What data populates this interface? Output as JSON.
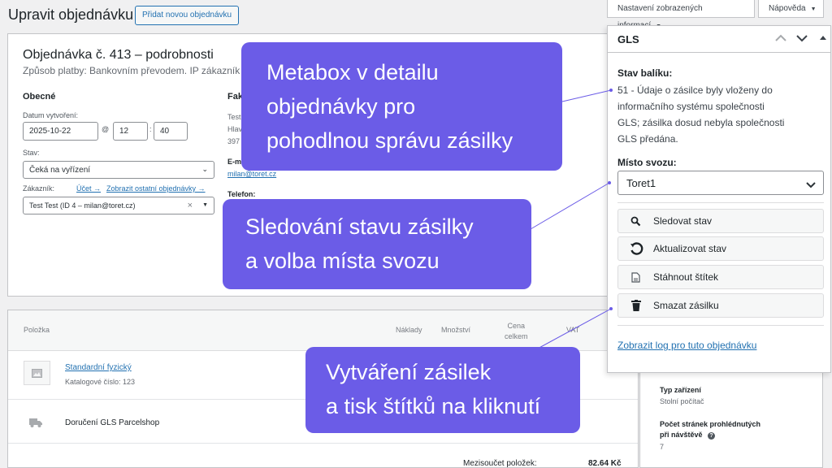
{
  "header": {
    "title": "Upravit objednávku",
    "add_button": "Přidat novou objednávku",
    "screen_options": "Nastavení zobrazených informací",
    "help": "Nápověda"
  },
  "order": {
    "heading": "Objednávka č. 413 – podrobnosti",
    "subheading": "Způsob platby: Bankovním převodem. IP zákazník",
    "general": {
      "heading": "Obecné",
      "date_label": "Datum vytvoření:",
      "date": "2025-10-22",
      "at": "@",
      "hour": "12",
      "colon": ":",
      "minute": "40",
      "status_label": "Stav:",
      "status": "Čeká na vyřízení",
      "customer_label": "Zákazník:",
      "account_link": "Účet →",
      "other_orders_link": "Zobrazit ostatní objednávky →",
      "customer": "Test Test (ID 4 – milan@toret.cz)",
      "clear": "×"
    },
    "billing": {
      "heading": "Fak",
      "line1": "Test",
      "line2": "Hlav",
      "line3": "397",
      "email_label": "E-m",
      "email": "milan@toret.cz",
      "phone_label": "Telefon:"
    }
  },
  "items": {
    "columns": [
      "Položka",
      "Náklady",
      "Množství",
      "Cena celkem",
      "VAT"
    ],
    "price_col_line1": "Cena",
    "price_col_line2": "celkem",
    "product_name": "Standardní fyzický",
    "sku": "Katalogové číslo: 123",
    "shipping": "Doručení GLS Parcelshop",
    "subtotal_label": "Mezisoučet položek:",
    "subtotal": "82.64 Kč"
  },
  "side": {
    "device_label": "Typ zařízení",
    "device_value": "Stolní počítač",
    "pages_label_1": "Počet stránek prohlédnutých",
    "pages_label_2": "při návštěvě",
    "pages_value": "7"
  },
  "gls": {
    "title": "GLS",
    "status_label": "Stav balíku:",
    "status_lines": [
      "51 - Údaje o zásilce byly vloženy do",
      "informačního systému společnosti",
      "GLS; zásilka dosud nebyla společnosti",
      "GLS předána."
    ],
    "pickup_label": "Místo svozu:",
    "pickup_value": "Toret1",
    "buttons": {
      "track": "Sledovat stav",
      "update": "Aktualizovat stav",
      "download": "Stáhnout štítek",
      "delete": "Smazat zásilku"
    },
    "log_link": "Zobrazit log pro tuto objednávku"
  },
  "callouts": {
    "c1": [
      "Metabox v detailu",
      "objednávky pro",
      "pohodlnou správu zásilky"
    ],
    "c2": [
      "Sledování stavu zásilky",
      "a volba místa svozu"
    ],
    "c3": [
      "Vytváření zásilek",
      "a tisk štítků na kliknutí"
    ]
  },
  "colors": {
    "callout": "#6b5ce7",
    "link": "#2271b1",
    "border": "#c3c4c7",
    "background": "#f0f0f1"
  }
}
